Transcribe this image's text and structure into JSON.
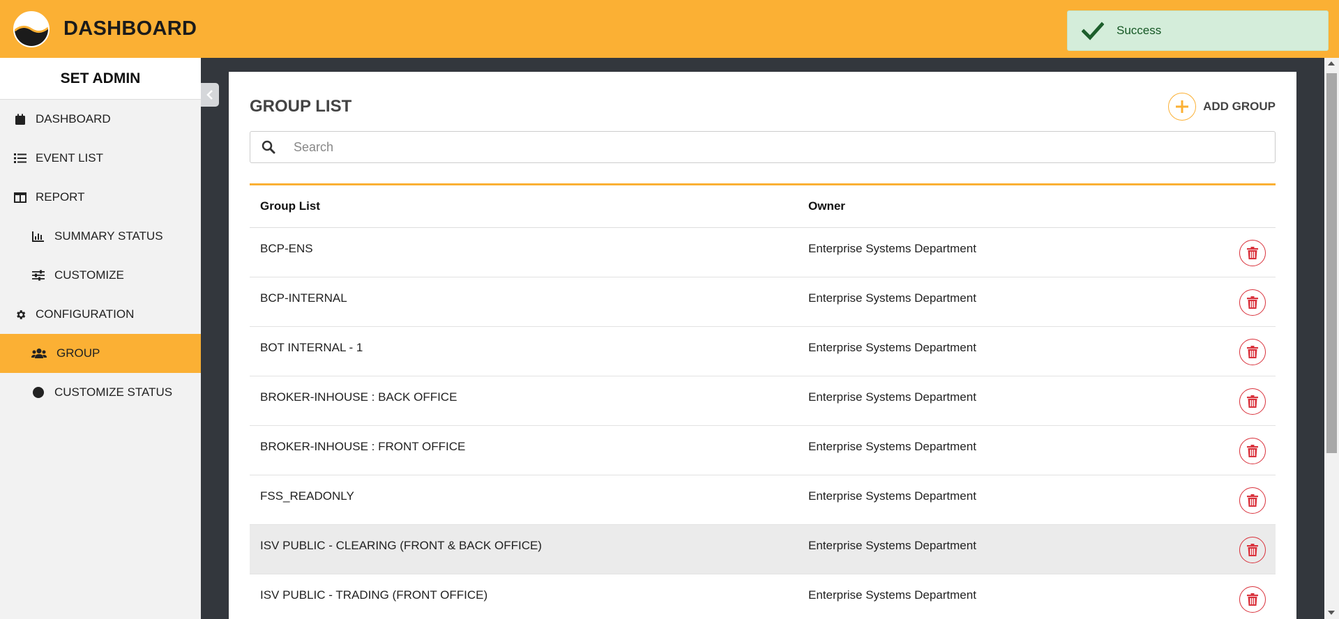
{
  "header": {
    "brand": "DASHBOARD",
    "logo_icon": "wave-logo-icon",
    "bg_color": "#fbb034"
  },
  "toast": {
    "message": "Success",
    "icon": "check-icon",
    "bg_color": "#d4edda"
  },
  "sidebar": {
    "title": "SET ADMIN",
    "items": [
      {
        "label": "DASHBOARD",
        "icon": "calendar-icon"
      },
      {
        "label": "EVENT LIST",
        "icon": "list-icon"
      },
      {
        "label": "REPORT",
        "icon": "table-icon"
      },
      {
        "label": "SUMMARY STATUS",
        "icon": "bar-chart-icon"
      },
      {
        "label": "CUSTOMIZE",
        "icon": "sliders-icon"
      },
      {
        "label": "CONFIGURATION",
        "icon": "gear-icon"
      },
      {
        "label": "GROUP",
        "icon": "users-icon",
        "active": true
      },
      {
        "label": "CUSTOMIZE STATUS",
        "icon": "circle-icon"
      }
    ]
  },
  "main": {
    "title": "GROUP LIST",
    "add_label": "ADD GROUP",
    "search": {
      "placeholder": "Search",
      "value": ""
    },
    "table": {
      "headers": [
        "Group List",
        "Owner",
        ""
      ],
      "rows": [
        {
          "group": "BCP-ENS",
          "owner": "Enterprise Systems Department"
        },
        {
          "group": "BCP-INTERNAL",
          "owner": "Enterprise Systems Department"
        },
        {
          "group": "BOT INTERNAL - 1",
          "owner": "Enterprise Systems Department"
        },
        {
          "group": "BROKER-INHOUSE : BACK OFFICE",
          "owner": "Enterprise Systems Department"
        },
        {
          "group": "BROKER-INHOUSE : FRONT OFFICE",
          "owner": "Enterprise Systems Department"
        },
        {
          "group": "FSS_READONLY",
          "owner": "Enterprise Systems Department"
        },
        {
          "group": "ISV PUBLIC - CLEARING (FRONT & BACK OFFICE)",
          "owner": "Enterprise Systems Department"
        },
        {
          "group": "ISV PUBLIC - TRADING (FRONT OFFICE)",
          "owner": "Enterprise Systems Department"
        }
      ]
    },
    "accent_color": "#fbb034",
    "delete_color": "#d9323c"
  }
}
